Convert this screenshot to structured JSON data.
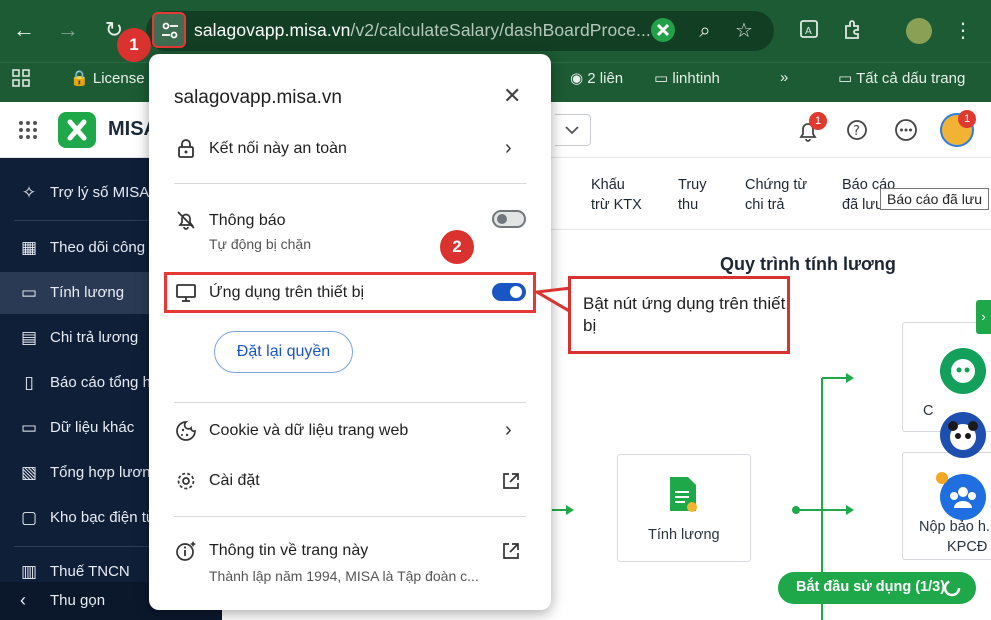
{
  "browser": {
    "url_host": "salagovapp.misa.vn",
    "url_path": "/v2/calculateSalary/dashBoardProce...",
    "bookmarks": [
      "License",
      "2 liên",
      "linhtinh",
      "»",
      "Tất cả dấu trang"
    ]
  },
  "annotations": {
    "step1": "1",
    "step2": "2",
    "callout_text": "Bật nút ứng dụng trên thiết bị"
  },
  "header": {
    "brand": "MISA",
    "notification_count": "1",
    "avatar_badge": "1"
  },
  "sidebar": {
    "items": [
      {
        "label": "Trợ lý số MISA",
        "icon": "sparkle-icon"
      },
      {
        "label": "Theo dõi công",
        "icon": "calendar-icon"
      },
      {
        "label": "Tính lương",
        "icon": "money-icon"
      },
      {
        "label": "Chi trả lương",
        "icon": "payment-icon"
      },
      {
        "label": "Báo cáo tổng h",
        "icon": "report-icon"
      },
      {
        "label": "Dữ liệu khác",
        "icon": "folder-icon"
      },
      {
        "label": "Tổng hợp lương",
        "icon": "summary-icon"
      },
      {
        "label": "Kho bạc điện tử",
        "icon": "treasury-icon"
      },
      {
        "label": "Thuế TNCN",
        "icon": "tax-icon"
      }
    ],
    "collapse_label": "Thu gọn"
  },
  "tabs": [
    {
      "label": "Khấu\ntrừ KTX"
    },
    {
      "label": "Truy\nthu"
    },
    {
      "label": "Chứng từ\nchi trả"
    },
    {
      "label": "Báo cáo\nđã lưu"
    }
  ],
  "tooltip": "Báo cáo đã lưu",
  "process": {
    "title": "Quy trình tính lương",
    "node_center": "Tính lương",
    "node_right_top": "C",
    "node_right_bottom_1": "Nộp bảo h...",
    "node_right_bottom_2": "KPCĐ"
  },
  "start_button": "Bắt đầu sử dụng (1/3)",
  "popup": {
    "domain": "salagovapp.misa.vn",
    "connection": "Kết nối này an toàn",
    "notifications_title": "Thông báo",
    "notifications_sub": "Tự động bị chặn",
    "device_apps": "Ứng dụng trên thiết bị",
    "reset_button": "Đặt lại quyền",
    "cookies": "Cookie và dữ liệu trang web",
    "settings": "Cài đặt",
    "about_title": "Thông tin về trang này",
    "about_sub": "Thành lập năm 1994, MISA là Tập đoàn c...",
    "notifications_enabled": false,
    "device_apps_enabled": true
  },
  "colors": {
    "chrome": "#1c5b34",
    "sidebar": "#0f1f38",
    "accent_green": "#1fa84a",
    "annotation_red": "#d9322f",
    "toggle_on": "#1a55c4"
  }
}
